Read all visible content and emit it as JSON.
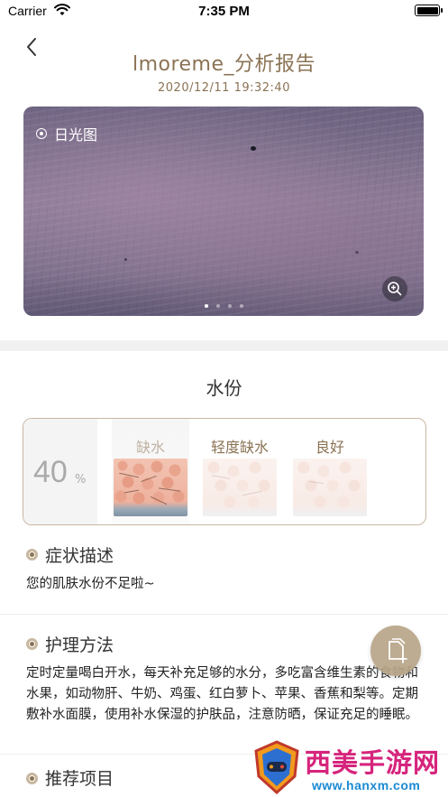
{
  "status_bar": {
    "carrier": "Carrier",
    "time": "7:35 PM",
    "battery_level": 1.0
  },
  "header": {
    "back_icon": "chevron-left-icon",
    "title": "lmoreme_分析报告",
    "date": "2020/12/11 19:32:40"
  },
  "image_viewer": {
    "label": "日光图",
    "zoom_icon": "zoom-in-icon",
    "page_count": 4,
    "active_page": 1
  },
  "moisture": {
    "section_title": "水份",
    "value": "40",
    "unit": "%",
    "levels": [
      {
        "label": "缺水",
        "active": true
      },
      {
        "label": "轻度缺水",
        "active": false
      },
      {
        "label": "良好",
        "active": false
      }
    ]
  },
  "symptoms": {
    "title": "症状描述",
    "text": "您的肌肤水份不足啦~"
  },
  "care": {
    "title": "护理方法",
    "text": "定时定量喝白开水，每天补充足够的水分，多吃富含维生素的食物和水果，如动物肝、牛奶、鸡蛋、红白萝卜、苹果、香蕉和梨等。定期敷补水面膜，使用补水保湿的护肤品，注意防晒，保证充足的睡眠。"
  },
  "recommend": {
    "title": "推荐项目"
  },
  "fab": {
    "icon": "add-document-icon"
  },
  "watermark": {
    "title": "西美手游网",
    "url": "www.hanxm.com"
  },
  "colors": {
    "accent": "#8b7355",
    "accent_light": "#c8b79f",
    "level_active": "#bfb3a3",
    "level_inactive": "#8b7355"
  }
}
